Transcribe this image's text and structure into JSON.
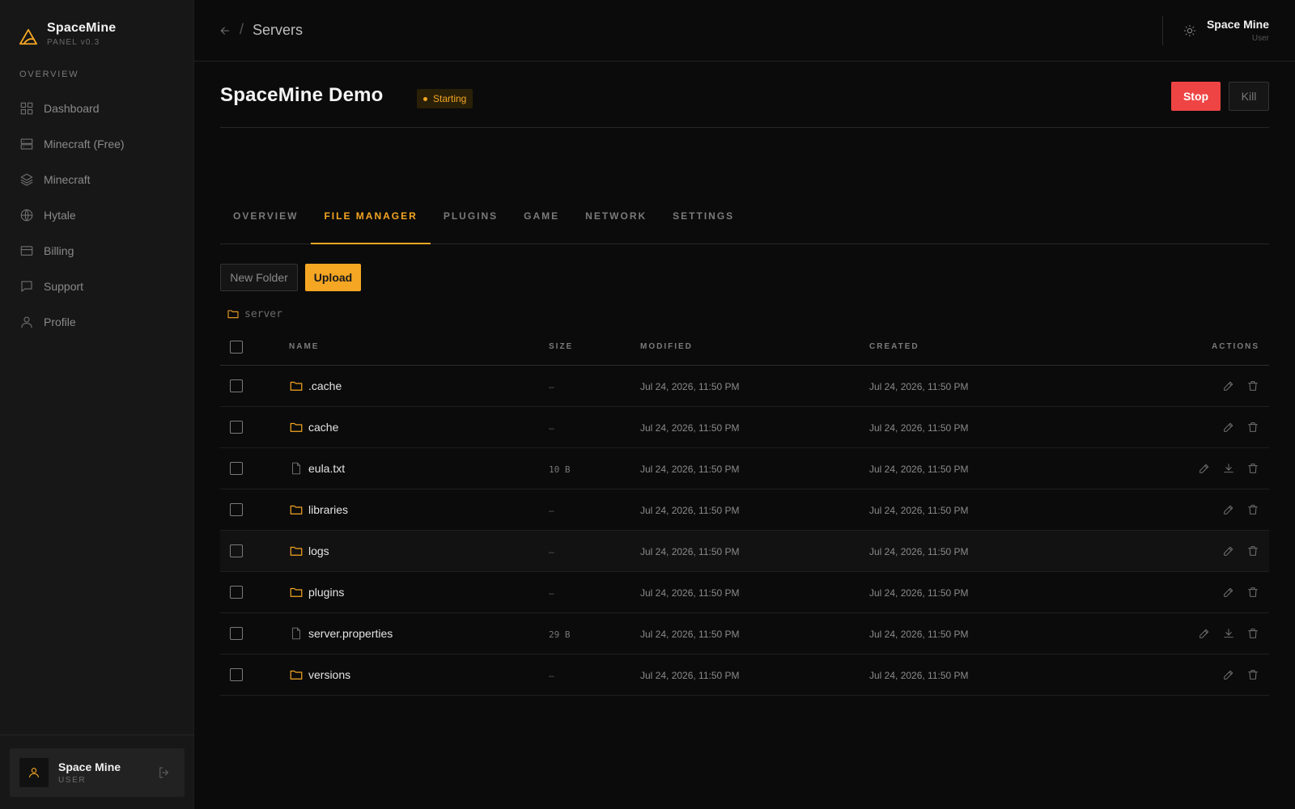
{
  "brand": {
    "name": "SpaceMine",
    "version": "PANEL v0.3"
  },
  "sidebar": {
    "section": "OVERVIEW",
    "items": [
      {
        "label": "Dashboard",
        "icon": "grid-icon"
      },
      {
        "label": "Minecraft (Free)",
        "icon": "server-icon"
      },
      {
        "label": "Minecraft",
        "icon": "layers-icon"
      },
      {
        "label": "Hytale",
        "icon": "globe-icon"
      },
      {
        "label": "Billing",
        "icon": "credit-card-icon"
      },
      {
        "label": "Support",
        "icon": "chat-icon"
      },
      {
        "label": "Profile",
        "icon": "user-icon"
      }
    ],
    "user": {
      "name": "Space Mine",
      "role": "USER"
    }
  },
  "topbar": {
    "separator": "/",
    "breadcrumb": "Servers",
    "user": {
      "name": "Space Mine",
      "role": "User"
    }
  },
  "server": {
    "title": "SpaceMine Demo",
    "status": "Starting",
    "stop_label": "Stop",
    "kill_label": "Kill"
  },
  "tabs": [
    {
      "label": "OVERVIEW",
      "active": false
    },
    {
      "label": "FILE MANAGER",
      "active": true
    },
    {
      "label": "PLUGINS",
      "active": false
    },
    {
      "label": "GAME",
      "active": false
    },
    {
      "label": "NETWORK",
      "active": false
    },
    {
      "label": "SETTINGS",
      "active": false
    }
  ],
  "files": {
    "new_folder_label": "New Folder",
    "upload_label": "Upload",
    "path": "server",
    "columns": {
      "name": "NAME",
      "size": "SIZE",
      "modified": "MODIFIED",
      "created": "CREATED",
      "actions": "ACTIONS"
    },
    "rows": [
      {
        "name": ".cache",
        "type": "folder",
        "size": "–",
        "modified": "Jul 24, 2026, 11:50 PM",
        "created": "Jul 24, 2026, 11:50 PM"
      },
      {
        "name": "cache",
        "type": "folder",
        "size": "–",
        "modified": "Jul 24, 2026, 11:50 PM",
        "created": "Jul 24, 2026, 11:50 PM"
      },
      {
        "name": "eula.txt",
        "type": "file",
        "size": "10 B",
        "modified": "Jul 24, 2026, 11:50 PM",
        "created": "Jul 24, 2026, 11:50 PM"
      },
      {
        "name": "libraries",
        "type": "folder",
        "size": "–",
        "modified": "Jul 24, 2026, 11:50 PM",
        "created": "Jul 24, 2026, 11:50 PM"
      },
      {
        "name": "logs",
        "type": "folder",
        "size": "–",
        "modified": "Jul 24, 2026, 11:50 PM",
        "created": "Jul 24, 2026, 11:50 PM"
      },
      {
        "name": "plugins",
        "type": "folder",
        "size": "–",
        "modified": "Jul 24, 2026, 11:50 PM",
        "created": "Jul 24, 2026, 11:50 PM"
      },
      {
        "name": "server.properties",
        "type": "file",
        "size": "29 B",
        "modified": "Jul 24, 2026, 11:50 PM",
        "created": "Jul 24, 2026, 11:50 PM"
      },
      {
        "name": "versions",
        "type": "folder",
        "size": "–",
        "modified": "Jul 24, 2026, 11:50 PM",
        "created": "Jul 24, 2026, 11:50 PM"
      }
    ]
  },
  "colors": {
    "accent": "#f5a623",
    "danger": "#ef4444",
    "background": "#0b0b0b",
    "sidebar": "#171717"
  }
}
